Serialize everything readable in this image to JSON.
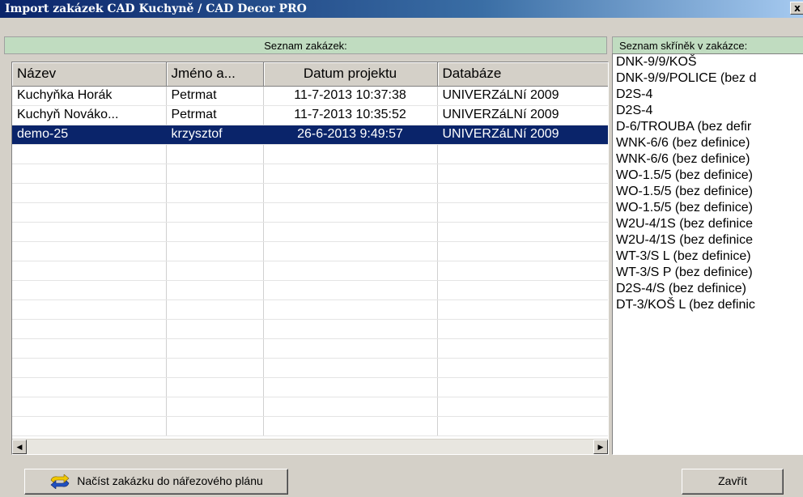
{
  "window": {
    "title": "Import zakázek CAD Kuchyně / CAD Decor PRO",
    "close_glyph": "x"
  },
  "orders_panel": {
    "header": "Seznam zakázek:",
    "columns": [
      "Název",
      "Jméno a...",
      "Datum projektu",
      "Databáze"
    ],
    "rows": [
      {
        "name": "Kuchyňka Horák",
        "user": "Petrmat",
        "date": "11-7-2013 10:37:38",
        "db": "UNIVERZáLNí 2009",
        "selected": false
      },
      {
        "name": "Kuchyň Nováko...",
        "user": "Petrmat",
        "date": "11-7-2013 10:35:52",
        "db": "UNIVERZáLNí 2009",
        "selected": false
      },
      {
        "name": "demo-25",
        "user": "krzysztof",
        "date": "26-6-2013 9:49:57",
        "db": "UNIVERZáLNí 2009",
        "selected": true
      }
    ],
    "empty_rows": 15
  },
  "cabinets_panel": {
    "header": "Seznam skříněk v zakázce:",
    "items": [
      "DNK-9/9/KOŠ",
      "DNK-9/9/POLICE (bez d",
      "D2S-4",
      "D2S-4",
      "D-6/TROUBA (bez defir",
      "WNK-6/6 (bez definice)",
      "WNK-6/6 (bez definice)",
      "WO-1.5/5 (bez definice)",
      "WO-1.5/5 (bez definice)",
      "WO-1.5/5 (bez definice)",
      "W2U-4/1S (bez definice",
      "W2U-4/1S (bez definice",
      "WT-3/S L (bez definice)",
      "WT-3/S P (bez definice)",
      "D2S-4/S (bez definice)",
      "DT-3/KOŠ L (bez definic"
    ]
  },
  "buttons": {
    "load": "Načíst zakázku do nářezového plánu",
    "load_icon": "swap-arrows-icon",
    "close": "Zavřít"
  },
  "colors": {
    "selection": "#0a246a",
    "header_green": "#c0dcc0",
    "arrow_yellow": "#f0c800",
    "arrow_blue": "#2050c0"
  }
}
